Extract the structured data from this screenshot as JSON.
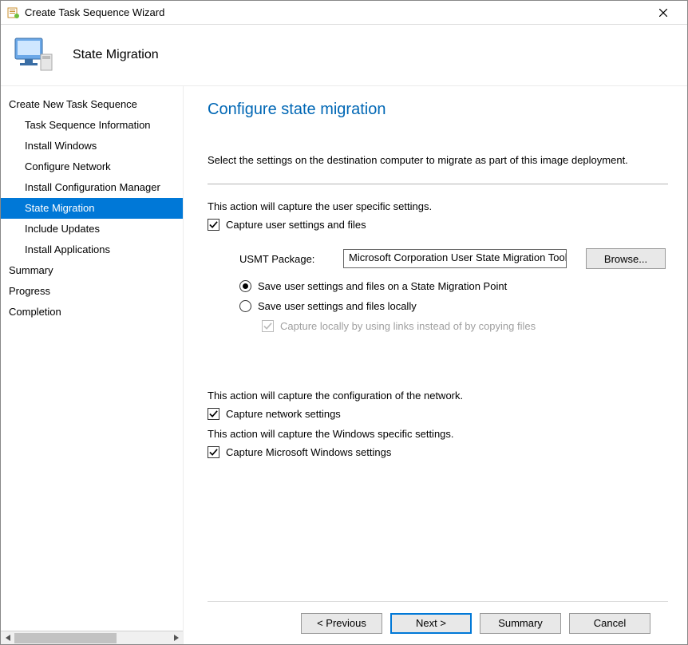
{
  "window": {
    "title": "Create Task Sequence Wizard"
  },
  "header": {
    "page_title": "State Migration"
  },
  "sidebar": {
    "items": [
      {
        "label": "Create New Task Sequence",
        "sub": false
      },
      {
        "label": "Task Sequence Information",
        "sub": true
      },
      {
        "label": "Install Windows",
        "sub": true
      },
      {
        "label": "Configure Network",
        "sub": true
      },
      {
        "label": "Install Configuration Manager",
        "sub": true
      },
      {
        "label": "State Migration",
        "sub": true
      },
      {
        "label": "Include Updates",
        "sub": true
      },
      {
        "label": "Install Applications",
        "sub": true
      },
      {
        "label": "Summary",
        "sub": false
      },
      {
        "label": "Progress",
        "sub": false
      },
      {
        "label": "Completion",
        "sub": false
      }
    ],
    "selected_index": 5
  },
  "main": {
    "heading": "Configure state migration",
    "intro": "Select the settings on the destination computer to migrate as part of this image deployment.",
    "capture_intro": "This action will capture the user specific settings.",
    "capture_user_chk": "Capture user settings and files",
    "usmt_label": "USMT Package:",
    "usmt_value": "Microsoft Corporation User State Migration Tool",
    "browse_btn": "Browse...",
    "radio_smp": "Save user settings and files on a State Migration Point",
    "radio_local": "Save user settings and files locally",
    "local_links_chk": "Capture locally by using links instead of by copying files",
    "network_intro": "This action will capture the configuration of the network.",
    "network_chk": "Capture network settings",
    "windows_intro": "This action will capture the Windows specific settings.",
    "windows_chk": "Capture Microsoft Windows settings"
  },
  "footer": {
    "previous": "< Previous",
    "next": "Next >",
    "summary": "Summary",
    "cancel": "Cancel"
  }
}
